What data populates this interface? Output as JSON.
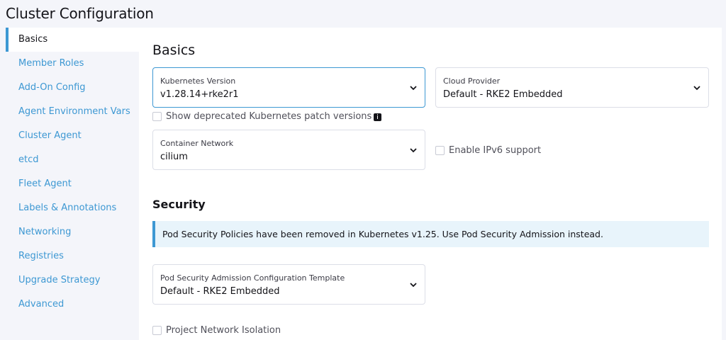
{
  "page_title": "Cluster Configuration",
  "sidebar": {
    "items": [
      {
        "label": "Basics",
        "active": true
      },
      {
        "label": "Member Roles"
      },
      {
        "label": "Add-On Config"
      },
      {
        "label": "Agent Environment Vars"
      },
      {
        "label": "Cluster Agent"
      },
      {
        "label": "etcd"
      },
      {
        "label": "Fleet Agent"
      },
      {
        "label": "Labels & Annotations"
      },
      {
        "label": "Networking"
      },
      {
        "label": "Registries"
      },
      {
        "label": "Upgrade Strategy"
      },
      {
        "label": "Advanced"
      }
    ]
  },
  "basics": {
    "heading": "Basics",
    "kubernetes_version": {
      "label": "Kubernetes Version",
      "value": "v1.28.14+rke2r1"
    },
    "cloud_provider": {
      "label": "Cloud Provider",
      "value": "Default - RKE2 Embedded"
    },
    "show_deprecated": {
      "label": "Show deprecated Kubernetes patch versions",
      "checked": false
    },
    "container_network": {
      "label": "Container Network",
      "value": "cilium"
    },
    "enable_ipv6": {
      "label": "Enable IPv6 support",
      "checked": false
    }
  },
  "security": {
    "heading": "Security",
    "banner": "Pod Security Policies have been removed in Kubernetes v1.25. Use Pod Security Admission instead.",
    "psa_template": {
      "label": "Pod Security Admission Configuration Template",
      "value": "Default - RKE2 Embedded"
    },
    "project_network_isolation": {
      "label": "Project Network Isolation",
      "checked": false
    }
  },
  "colors": {
    "accent": "#3d98d3",
    "banner_bg": "#e8f4fb",
    "sidebar_bg": "#f4f5fa"
  }
}
